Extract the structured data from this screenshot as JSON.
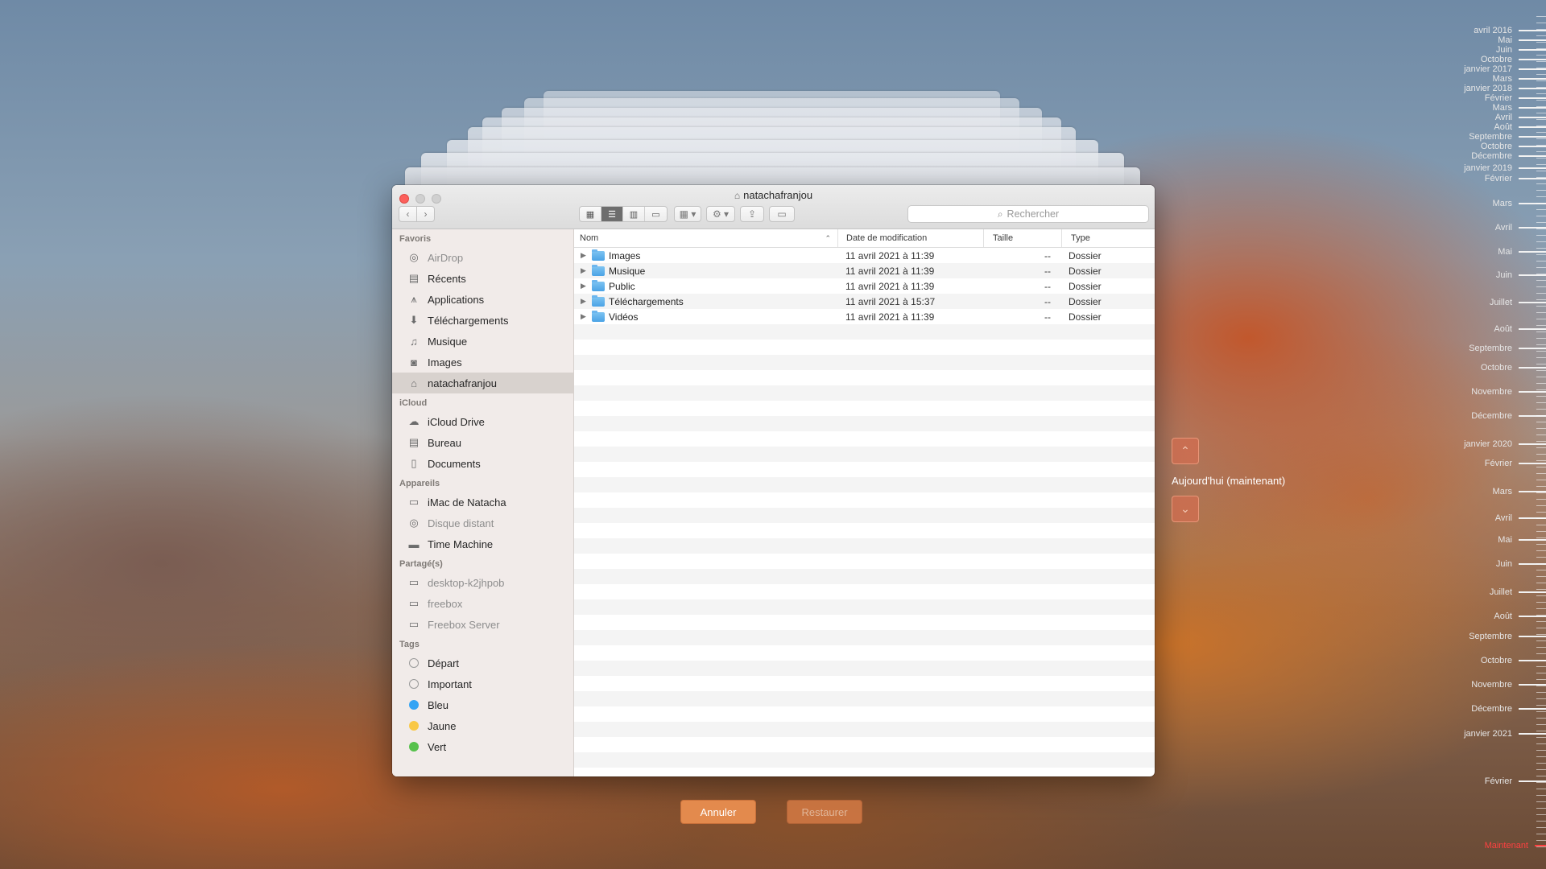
{
  "window": {
    "title": "natachafranjou"
  },
  "toolbar": {
    "back_label": "‹",
    "forward_label": "›",
    "search_placeholder": "Rechercher",
    "view_modes": [
      "icons",
      "list",
      "columns",
      "gallery"
    ],
    "active_view": "list"
  },
  "sidebar": {
    "favoris_title": "Favoris",
    "favoris": [
      {
        "label": "AirDrop",
        "icon": "airdrop-icon",
        "dim": true
      },
      {
        "label": "Récents",
        "icon": "recents-icon"
      },
      {
        "label": "Applications",
        "icon": "applications-icon"
      },
      {
        "label": "Téléchargements",
        "icon": "downloads-icon"
      },
      {
        "label": "Musique",
        "icon": "music-icon"
      },
      {
        "label": "Images",
        "icon": "camera-icon"
      },
      {
        "label": "natachafranjou",
        "icon": "home-icon",
        "selected": true
      }
    ],
    "icloud_title": "iCloud",
    "icloud": [
      {
        "label": "iCloud Drive",
        "icon": "cloud-icon"
      },
      {
        "label": "Bureau",
        "icon": "desktop-icon"
      },
      {
        "label": "Documents",
        "icon": "document-icon"
      }
    ],
    "appareils_title": "Appareils",
    "appareils": [
      {
        "label": "iMac de Natacha",
        "icon": "imac-icon"
      },
      {
        "label": "Disque distant",
        "icon": "disc-icon",
        "dim": true
      },
      {
        "label": "Time Machine",
        "icon": "drive-icon"
      }
    ],
    "partages_title": "Partagé(s)",
    "partages": [
      {
        "label": "desktop-k2jhpob",
        "icon": "monitor-icon",
        "dim": true
      },
      {
        "label": "freebox",
        "icon": "monitor-icon",
        "dim": true
      },
      {
        "label": "Freebox Server",
        "icon": "server-icon",
        "dim": true
      }
    ],
    "tags_title": "Tags",
    "tags": [
      {
        "label": "Départ",
        "color": "transparent"
      },
      {
        "label": "Important",
        "color": "transparent"
      },
      {
        "label": "Bleu",
        "color": "#34a4f4"
      },
      {
        "label": "Jaune",
        "color": "#f9c846"
      },
      {
        "label": "Vert",
        "color": "#57c14c"
      }
    ]
  },
  "list": {
    "columns": {
      "nom": "Nom",
      "date": "Date de modification",
      "taille": "Taille",
      "type": "Type"
    },
    "rows": [
      {
        "name": "Images",
        "date": "11 avril 2021 à 11:39",
        "size": "--",
        "type": "Dossier"
      },
      {
        "name": "Musique",
        "date": "11 avril 2021 à 11:39",
        "size": "--",
        "type": "Dossier"
      },
      {
        "name": "Public",
        "date": "11 avril 2021 à 11:39",
        "size": "--",
        "type": "Dossier"
      },
      {
        "name": "Téléchargements",
        "date": "11 avril 2021 à 15:37",
        "size": "--",
        "type": "Dossier"
      },
      {
        "name": "Vidéos",
        "date": "11 avril 2021 à 11:39",
        "size": "--",
        "type": "Dossier"
      }
    ]
  },
  "actions": {
    "cancel_label": "Annuler",
    "restore_label": "Restaurer"
  },
  "time_machine": {
    "today_label": "Aujourd'hui (maintenant)",
    "timeline": [
      "avril 2016",
      "Mai",
      "Juin",
      "Octobre",
      "janvier 2017",
      "Mars",
      "janvier 2018",
      "Février",
      "Mars",
      "Avril",
      "Août",
      "Septembre",
      "Octobre",
      "Décembre",
      "janvier 2019",
      "Février",
      "Mars",
      "Avril",
      "Mai",
      "Juin",
      "Juillet",
      "Août",
      "Septembre",
      "Octobre",
      "Novembre",
      "Décembre",
      "janvier 2020",
      "Février",
      "Mars",
      "Avril",
      "Mai",
      "Juin",
      "Juillet",
      "Août",
      "Septembre",
      "Octobre",
      "Novembre",
      "Décembre",
      "janvier 2021",
      "Février",
      "Maintenant"
    ]
  }
}
